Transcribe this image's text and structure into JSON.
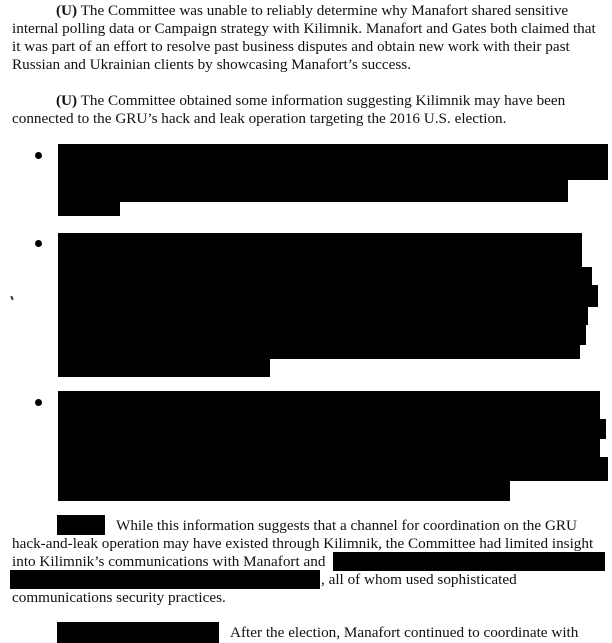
{
  "p1": {
    "marker": "(U)",
    "lines": [
      "The Committee was unable to reliably determine why Manafort shared sensitive",
      "internal polling data or Campaign strategy with Kilimnik.  Manafort and Gates both claimed that",
      "it was part of an effort to resolve past business disputes and obtain new work with their past",
      "Russian and Ukrainian clients by showcasing Manafort’s success."
    ]
  },
  "p2": {
    "marker": "(U)",
    "lines": [
      "The Committee obtained some information suggesting Kilimnik may have been",
      "connected to the GRU’s hack and leak operation targeting the 2016 U.S. election."
    ]
  },
  "p3": {
    "line1_after_redaction": "While this information suggests that a channel for coordination on the GRU",
    "line2": "hack-and-leak operation may have existed through Kilimnik, the Committee had limited insight",
    "line3_before_redaction": "into Kilimnik’s communications with Manafort and",
    "line4_after_redaction": ", all of whom used sophisticated",
    "line5": "communications security practices."
  },
  "p4": {
    "line1_after_redaction": "After the election, Manafort continued to coordinate with"
  }
}
